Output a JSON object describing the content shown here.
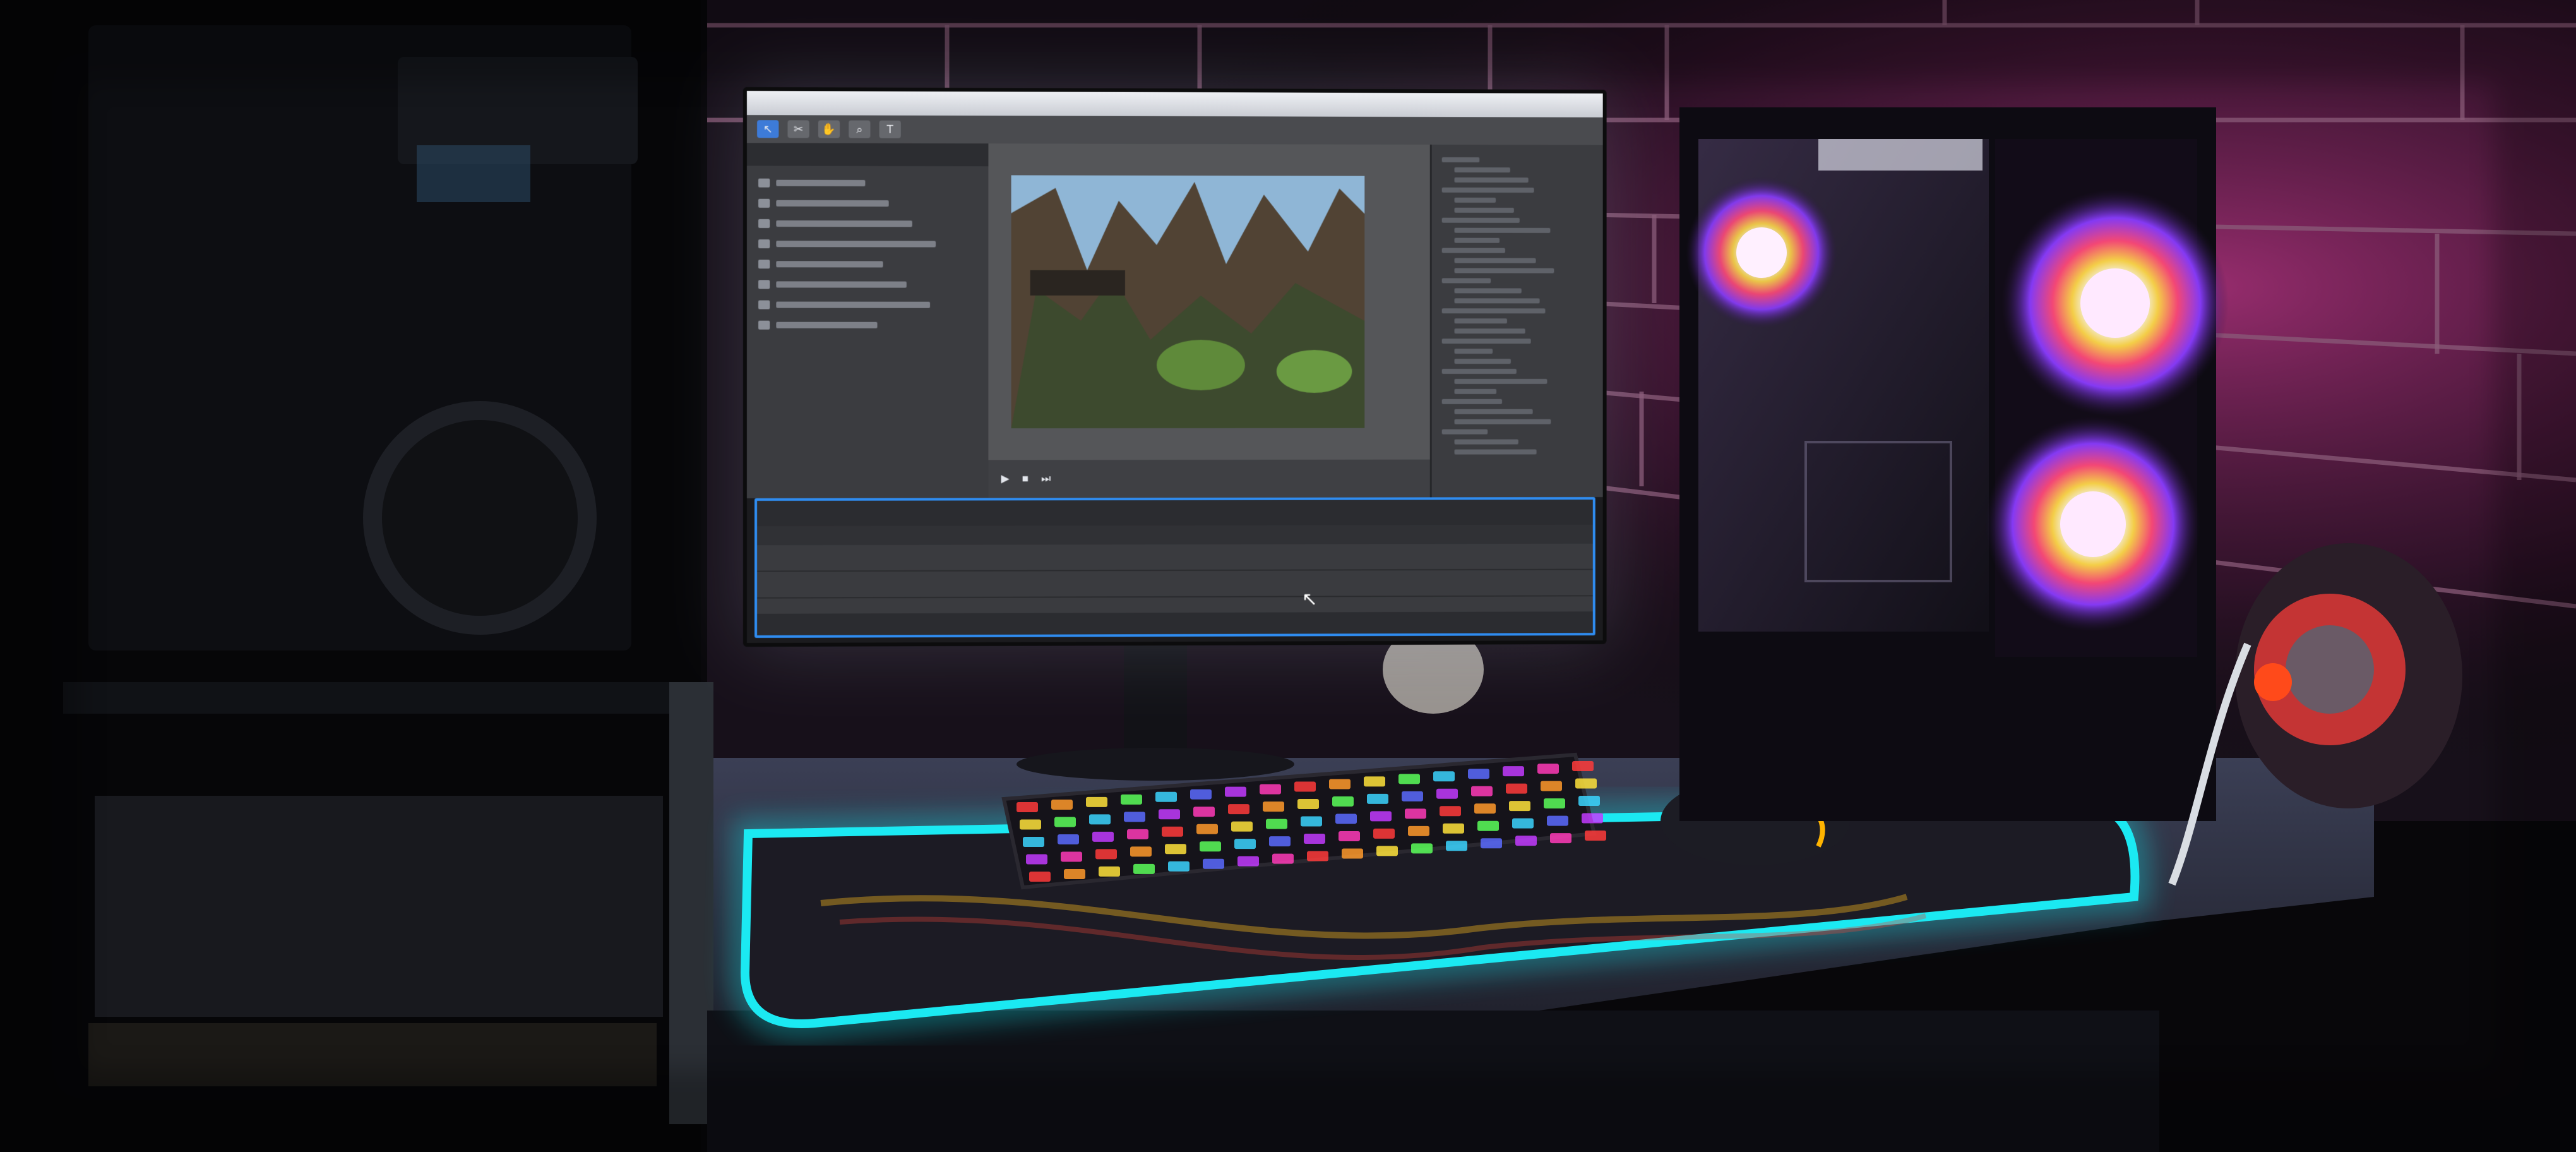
{
  "scene": {
    "objects": [
      "monitor",
      "keyboard",
      "mouse",
      "desk-mat",
      "pc-case",
      "speaker",
      "shelf",
      "brick-wall"
    ],
    "lighting": {
      "desk_mat_glow": "#16e6f0",
      "wall_glow": "#d23c8c",
      "fan_colors": [
        "#ff2d6a",
        "#ffb400",
        "#4cff7a",
        "#23a8ff",
        "#b34dff"
      ]
    }
  },
  "monitor": {
    "app": "video-editor",
    "menu": [
      "",
      "",
      "",
      "",
      ""
    ],
    "toolbar_icons": [
      "select-tool",
      "razor-tool",
      "hand-tool",
      "zoom-tool",
      "type-tool"
    ],
    "project_panel": {
      "tab": "",
      "file_count": 8
    },
    "viewer": {
      "content": "rocky-canyon-scene",
      "controls": [
        "play",
        "stop",
        "step"
      ]
    },
    "effects_panel": {
      "item_count": 30
    },
    "timeline": {
      "timecode": "",
      "track_count": 4
    },
    "status": [
      "",
      "",
      "",
      ""
    ]
  },
  "keyboard": {
    "key_colors": [
      "#ff3b3b",
      "#ff9a2b",
      "#ffe33b",
      "#5bff5b",
      "#3bd5ff",
      "#5b6bff",
      "#c23bff",
      "#ff3bb8"
    ]
  }
}
